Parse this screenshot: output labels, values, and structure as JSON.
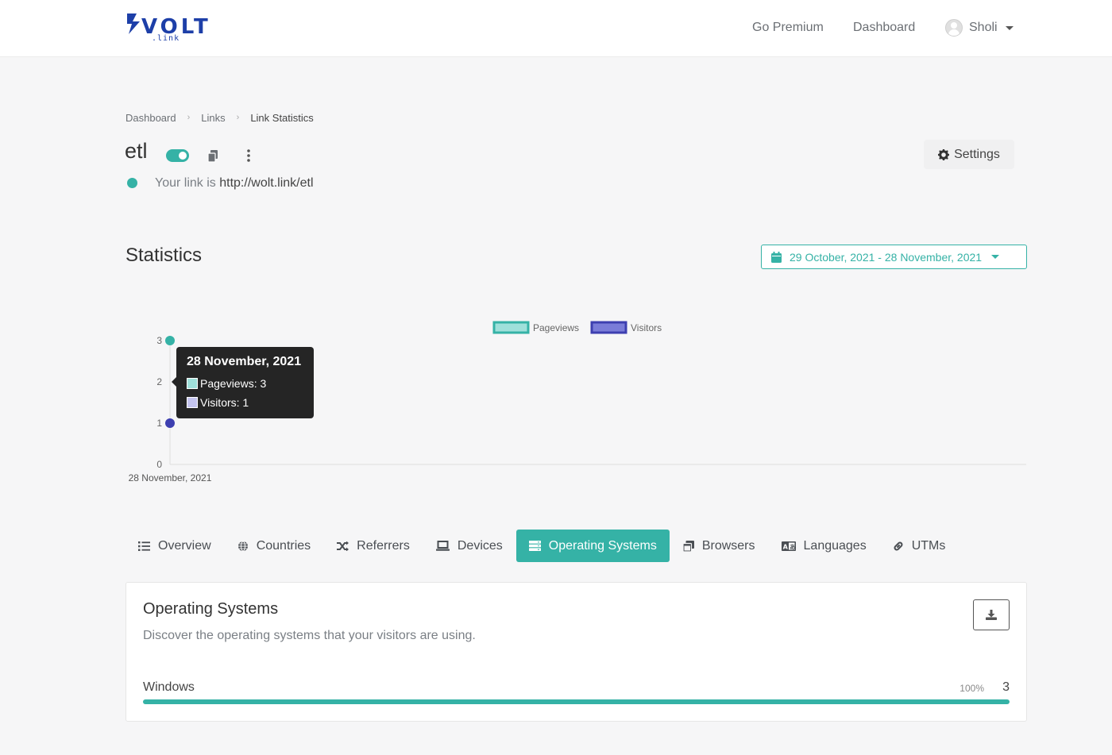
{
  "header": {
    "logo": {
      "text": "VOLT",
      "subtext": ".link"
    },
    "nav": {
      "premium": "Go Premium",
      "dashboard": "Dashboard"
    },
    "user": {
      "name": "Sholi"
    }
  },
  "breadcrumb": [
    "Dashboard",
    "Links",
    "Link Statistics"
  ],
  "link": {
    "title": "etl",
    "enabled": true,
    "prefix": "Your link is",
    "url": "http://wolt.link/etl"
  },
  "settings_label": "Settings",
  "stats": {
    "title": "Statistics",
    "date_range": "29 October, 2021 - 28 November, 2021"
  },
  "colors": {
    "accent": "#35b2a6",
    "pageviews": "#35b2a6",
    "visitors": "#3d3fb0"
  },
  "chart_data": {
    "type": "line",
    "x": [
      "28 November, 2021"
    ],
    "series": [
      {
        "name": "Pageviews",
        "values": [
          3
        ]
      },
      {
        "name": "Visitors",
        "values": [
          1
        ]
      }
    ],
    "yticks": [
      0,
      1,
      2,
      3
    ],
    "ylim": [
      0,
      3
    ],
    "legend": "top",
    "tooltip": {
      "title": "28 November, 2021",
      "rows": [
        "Pageviews: 3",
        "Visitors: 1"
      ]
    }
  },
  "tabs": [
    {
      "label": "Overview",
      "icon": "list-icon",
      "active": false
    },
    {
      "label": "Countries",
      "icon": "globe-icon",
      "active": false
    },
    {
      "label": "Referrers",
      "icon": "shuffle-icon",
      "active": false
    },
    {
      "label": "Devices",
      "icon": "laptop-icon",
      "active": false
    },
    {
      "label": "Operating Systems",
      "icon": "server-icon",
      "active": true
    },
    {
      "label": "Browsers",
      "icon": "window-icon",
      "active": false
    },
    {
      "label": "Languages",
      "icon": "language-icon",
      "active": false
    },
    {
      "label": "UTMs",
      "icon": "link-icon",
      "active": false
    }
  ],
  "os_card": {
    "title": "Operating Systems",
    "description": "Discover the operating systems that your visitors are using.",
    "rows": [
      {
        "name": "Windows",
        "percent_label": "100%",
        "percent": 100,
        "count": "3"
      }
    ]
  }
}
